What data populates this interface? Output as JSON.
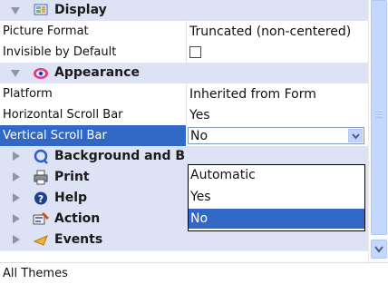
{
  "grid": {
    "categories": {
      "display": {
        "label": "Display",
        "expanded": true,
        "icon": "display-icon"
      },
      "appearance": {
        "label": "Appearance",
        "expanded": true,
        "icon": "appearance-icon"
      },
      "background": {
        "label": "Background and B",
        "expanded": false,
        "icon": "background-icon"
      },
      "print": {
        "label": "Print",
        "expanded": false,
        "icon": "printer-icon"
      },
      "help": {
        "label": "Help",
        "expanded": false,
        "icon": "help-icon"
      },
      "action": {
        "label": "Action",
        "expanded": false,
        "icon": "action-icon"
      },
      "events": {
        "label": "Events",
        "expanded": false,
        "icon": "events-icon"
      }
    },
    "properties": {
      "picture_format": {
        "name": "Picture Format",
        "value": "Truncated (non-centered)"
      },
      "invisible_by_default": {
        "name": "Invisible by Default",
        "checked": false
      },
      "platform": {
        "name": "Platform",
        "value": "Inherited from Form"
      },
      "horizontal_scroll_bar": {
        "name": "Horizontal Scroll Bar",
        "value": "Yes"
      },
      "vertical_scroll_bar": {
        "name": "Vertical Scroll Bar",
        "value": "No",
        "selected": true
      }
    }
  },
  "dropdown": {
    "options": [
      "Automatic",
      "Yes",
      "No"
    ],
    "selected": "No"
  },
  "status_bar": {
    "text": "All Themes"
  },
  "colors": {
    "category_bg": "#dde3f4",
    "selection": "#3168c5",
    "scrollbar": "#c4d7fd"
  }
}
